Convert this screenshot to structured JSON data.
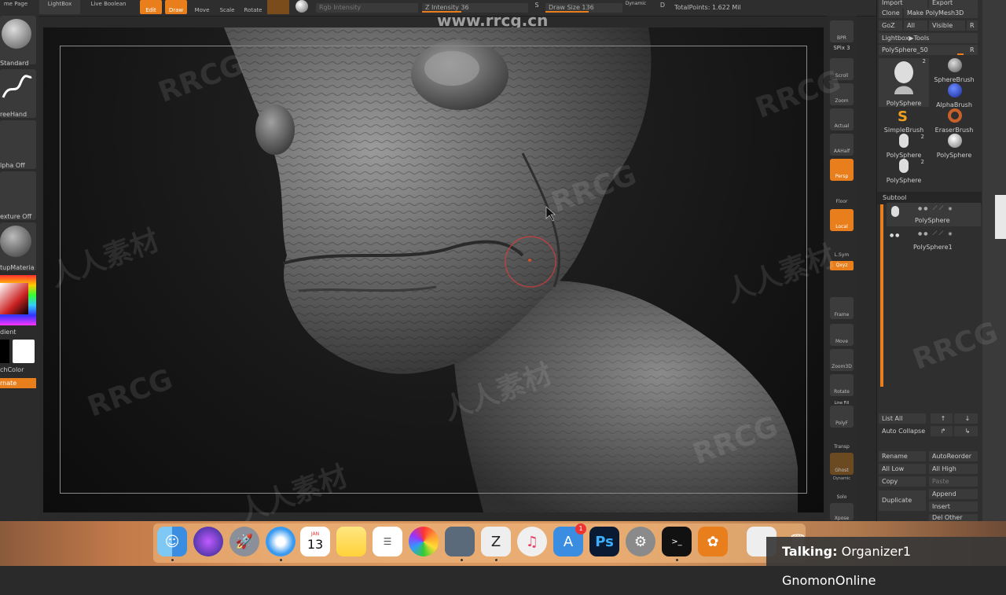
{
  "topbar": {
    "home_page": "me Page",
    "lightbox": "LightBox",
    "live_boolean": "Live Boolean",
    "edit": "Edit",
    "draw": "Draw",
    "move": "Move",
    "scale": "Scale",
    "rotate": "Rotate",
    "rgb_intensity": "Rgb Intensity",
    "z_intensity": "Z Intensity 36",
    "s_label": "S",
    "draw_size": "Draw Size 136",
    "dynamic": "Dynamic",
    "d_label": "D",
    "total_points": "TotalPoints: 1.622 Mil",
    "site_watermark": "www.rrcg.cn"
  },
  "left_panel": {
    "standard": "Standard",
    "freehand": "reeHand",
    "alpha_off": "lpha Off",
    "texture_off": "exture Off",
    "material": "tupMateria",
    "gradient": "dient",
    "switch_color": "chColor",
    "alternate": "rnate"
  },
  "right_tools": {
    "bpr": "BPR",
    "spix": "SPix 3",
    "scroll": "Scroll",
    "zoom": "Zoom",
    "actual": "Actual",
    "aahalf": "AAHalf",
    "persp": "Persp",
    "floor": "Floor",
    "local": "Local",
    "lsym": "L.Sym",
    "xyz": "Qxyz",
    "frame": "Frame",
    "move": "Move",
    "zoom3d": "Zoom3D",
    "rotate": "Rotate",
    "line_fill": "Line Fill",
    "polyf": "PolyF",
    "transp": "Transp",
    "ghost": "Ghost",
    "dynamic": "Dynamic",
    "solo": "Solo",
    "xpose": "Xpose"
  },
  "right_panel": {
    "import": "Import",
    "export": "Export",
    "clone": "Clone",
    "make_polymesh": "Make PolyMesh3D",
    "goz": "GoZ",
    "all": "All",
    "visible": "Visible",
    "r": "R",
    "lightbox_tools": "Lightbox▶Tools",
    "polysphere_label": "PolySphere_50",
    "r2": "R",
    "tools": [
      {
        "name": "PolySphere",
        "count": "2"
      },
      {
        "name": "SphereBrush",
        "count": ""
      },
      {
        "name": "AlphaBrush",
        "count": ""
      },
      {
        "name": "SimpleBrush",
        "count": ""
      },
      {
        "name": "EraserBrush",
        "count": ""
      },
      {
        "name": "PolySphere",
        "count": "2"
      },
      {
        "name": "PolySphere",
        "count": ""
      },
      {
        "name": "PolySphere",
        "count": "2"
      }
    ],
    "subtool_title": "Subtool",
    "subtools": [
      "PolySphere",
      "PolySphere1"
    ],
    "list_all": "List All",
    "auto_collapse": "Auto Collapse",
    "rename": "Rename",
    "auto_reorder": "AutoReorder",
    "all_low": "All Low",
    "all_high": "All High",
    "copy": "Copy",
    "paste": "Paste",
    "duplicate": "Duplicate",
    "append": "Append",
    "insert": "Insert",
    "del_other": "Del Other"
  },
  "dock": {
    "calendar_month": "JAN",
    "calendar_day": "13",
    "ps_label": "Ps",
    "appstore_badge": "1"
  },
  "talking": {
    "label": "Talking:",
    "names": "Organizer1 GnomonOnline"
  },
  "watermarks": [
    "RRCG",
    "人人素材"
  ]
}
